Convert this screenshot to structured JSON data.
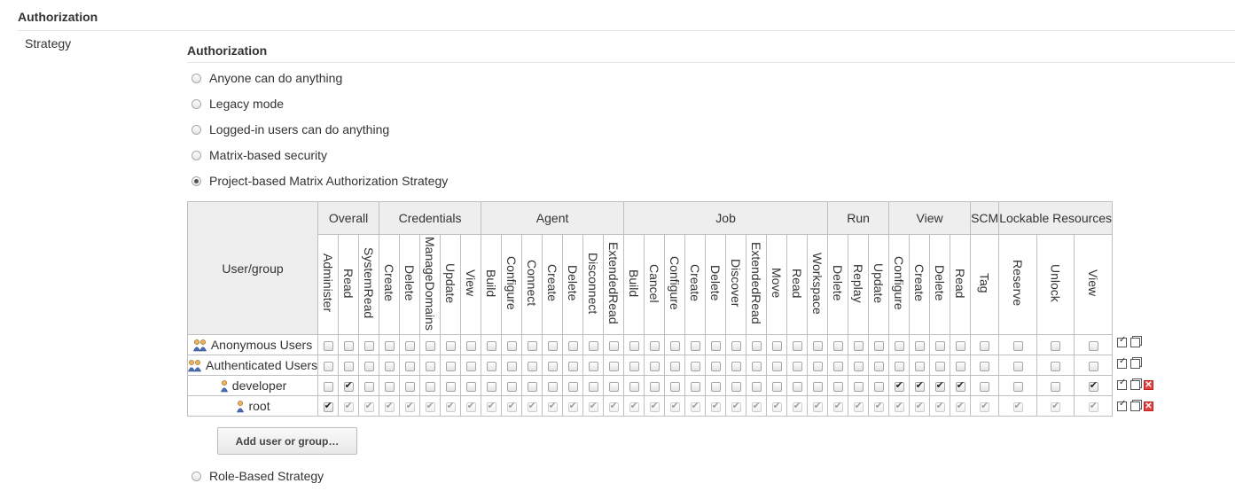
{
  "section_title": "Authorization",
  "strategy_label": "Strategy",
  "subsection_title": "Authorization",
  "strategies": [
    {
      "label": "Anyone can do anything",
      "selected": false
    },
    {
      "label": "Legacy mode",
      "selected": false
    },
    {
      "label": "Logged-in users can do anything",
      "selected": false
    },
    {
      "label": "Matrix-based security",
      "selected": false
    },
    {
      "label": "Project-based Matrix Authorization Strategy",
      "selected": true
    }
  ],
  "role_based": {
    "label": "Role-Based Strategy",
    "selected": false
  },
  "matrix": {
    "user_group_header": "User/group",
    "groups": [
      {
        "name": "Overall",
        "perms": [
          "Administer",
          "Read",
          "SystemRead"
        ]
      },
      {
        "name": "Credentials",
        "perms": [
          "Create",
          "Delete",
          "ManageDomains",
          "Update",
          "View"
        ]
      },
      {
        "name": "Agent",
        "perms": [
          "Build",
          "Configure",
          "Connect",
          "Create",
          "Delete",
          "Disconnect",
          "ExtendedRead"
        ]
      },
      {
        "name": "Job",
        "perms": [
          "Build",
          "Cancel",
          "Configure",
          "Create",
          "Delete",
          "Discover",
          "ExtendedRead",
          "Move",
          "Read",
          "Workspace"
        ]
      },
      {
        "name": "Run",
        "perms": [
          "Delete",
          "Replay",
          "Update"
        ]
      },
      {
        "name": "View",
        "perms": [
          "Configure",
          "Create",
          "Delete",
          "Read"
        ]
      },
      {
        "name": "SCM",
        "perms": [
          "Tag"
        ]
      },
      {
        "name": "Lockable Resources",
        "perms": [
          "Reserve",
          "Unlock",
          "View"
        ]
      }
    ],
    "rows": [
      {
        "name": "Anonymous Users",
        "icon": "group-icon",
        "checked": [],
        "all_implied": false,
        "deletable": false
      },
      {
        "name": "Authenticated Users",
        "icon": "group-icon",
        "checked": [],
        "all_implied": false,
        "deletable": false
      },
      {
        "name": "developer",
        "icon": "user-icon",
        "checked": [
          1,
          28,
          29,
          30,
          31,
          35
        ],
        "all_implied": false,
        "deletable": true
      },
      {
        "name": "root",
        "icon": "user-icon",
        "checked": [
          0
        ],
        "all_implied": true,
        "deletable": true
      }
    ]
  },
  "add_button_label": "Add user or group…"
}
